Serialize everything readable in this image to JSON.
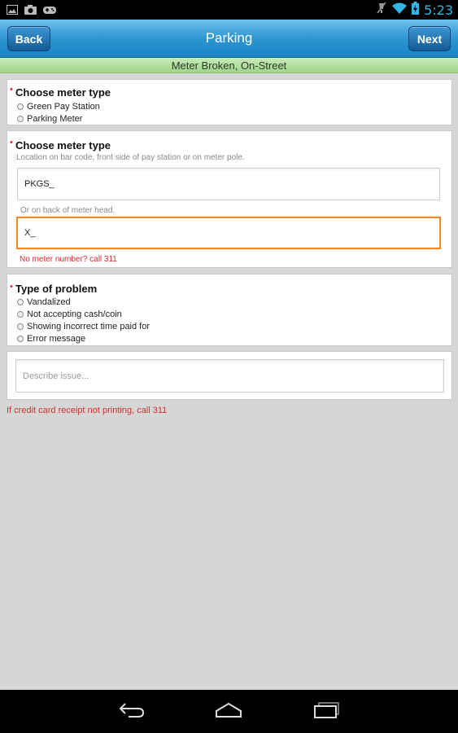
{
  "status_bar": {
    "time": "5:23",
    "left_icons": [
      "image-icon",
      "camera-icon",
      "gamepad-icon"
    ],
    "right_icons": [
      "mute-icon",
      "wifi-icon",
      "battery-icon"
    ],
    "time_color": "#33b5e5"
  },
  "action_bar": {
    "back_label": "Back",
    "title": "Parking",
    "next_label": "Next"
  },
  "sub_header": "Meter Broken, On-Street",
  "meter_type_section": {
    "title": "Choose meter type",
    "options": [
      "Green Pay Station",
      "Parking Meter"
    ]
  },
  "meter_number_section": {
    "title": "Choose meter type",
    "helper_1": "Location on bar code, front side of pay station or on meter pole.",
    "pkgs_value": "PKGS_",
    "helper_2": "Or on back of meter head.",
    "x_value": "X_",
    "no_number_text": "No meter number? call 311"
  },
  "problem_section": {
    "title": "Type of problem",
    "options": [
      "Vandalized",
      "Not accepting cash/coin",
      "Showing incorrect time paid for",
      "Error message"
    ]
  },
  "describe": {
    "placeholder": "Describe issue..."
  },
  "footer_note": "If credit card receipt not printing, call 311",
  "colors": {
    "action_bar": "#2e95d3",
    "sub_header": "#b3e0a0",
    "required": "#e23333",
    "focus": "#f08a24",
    "warning_text": "#d32f2f"
  },
  "nav_bar": [
    "back-icon",
    "home-icon",
    "recent-apps-icon"
  ]
}
